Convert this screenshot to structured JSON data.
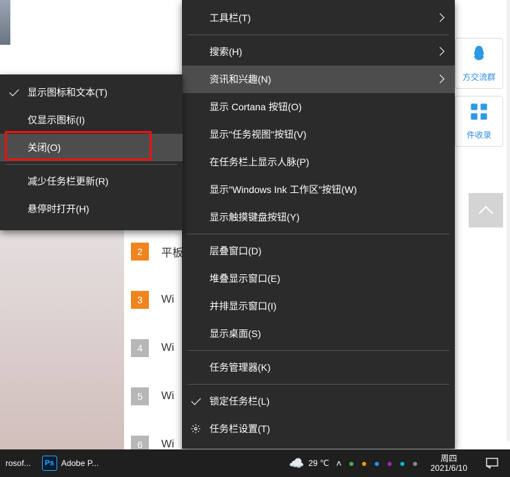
{
  "submenu": {
    "items": [
      {
        "label": "显示图标和文本(T)",
        "checked": true
      },
      {
        "label": "仅显示图标(I)"
      },
      {
        "label": "关闭(O)",
        "highlight": true
      },
      {
        "label": "减少任务栏更新(R)"
      },
      {
        "label": "悬停时打开(H)"
      }
    ]
  },
  "mainmenu": {
    "groups": [
      [
        {
          "label": "工具栏(T)",
          "arrow": true
        }
      ],
      [
        {
          "label": "搜索(H)",
          "arrow": true
        },
        {
          "label": "资讯和兴趣(N)",
          "arrow": true,
          "active": true
        },
        {
          "label": "显示 Cortana 按钮(O)"
        },
        {
          "label": "显示\"任务视图\"按钮(V)"
        },
        {
          "label": "在任务栏上显示人脉(P)"
        },
        {
          "label": "显示\"Windows Ink 工作区\"按钮(W)"
        },
        {
          "label": "显示触摸键盘按钮(Y)"
        }
      ],
      [
        {
          "label": "层叠窗口(D)"
        },
        {
          "label": "堆叠显示窗口(E)"
        },
        {
          "label": "并排显示窗口(I)"
        },
        {
          "label": "显示桌面(S)"
        }
      ],
      [
        {
          "label": "任务管理器(K)"
        }
      ],
      [
        {
          "label": "锁定任务栏(L)",
          "checked": true
        },
        {
          "label": "任务栏设置(T)",
          "icon": "gear"
        }
      ]
    ]
  },
  "bg_list": [
    {
      "num": "2",
      "color": "orange",
      "text": "平板"
    },
    {
      "num": "3",
      "color": "orange",
      "text": "Wi"
    },
    {
      "num": "4",
      "color": "grey",
      "text": "Wi"
    },
    {
      "num": "5",
      "color": "grey",
      "text": "Wi"
    },
    {
      "num": "6",
      "color": "grey",
      "text": "Wi"
    }
  ],
  "right_cards": [
    {
      "label": "方交流群"
    },
    {
      "label": "件收录"
    }
  ],
  "taskbar": {
    "app1": "rosof...",
    "app2": "Adobe P...",
    "temp": "29 ℃",
    "day": "周四",
    "date": "2021/6/10"
  }
}
